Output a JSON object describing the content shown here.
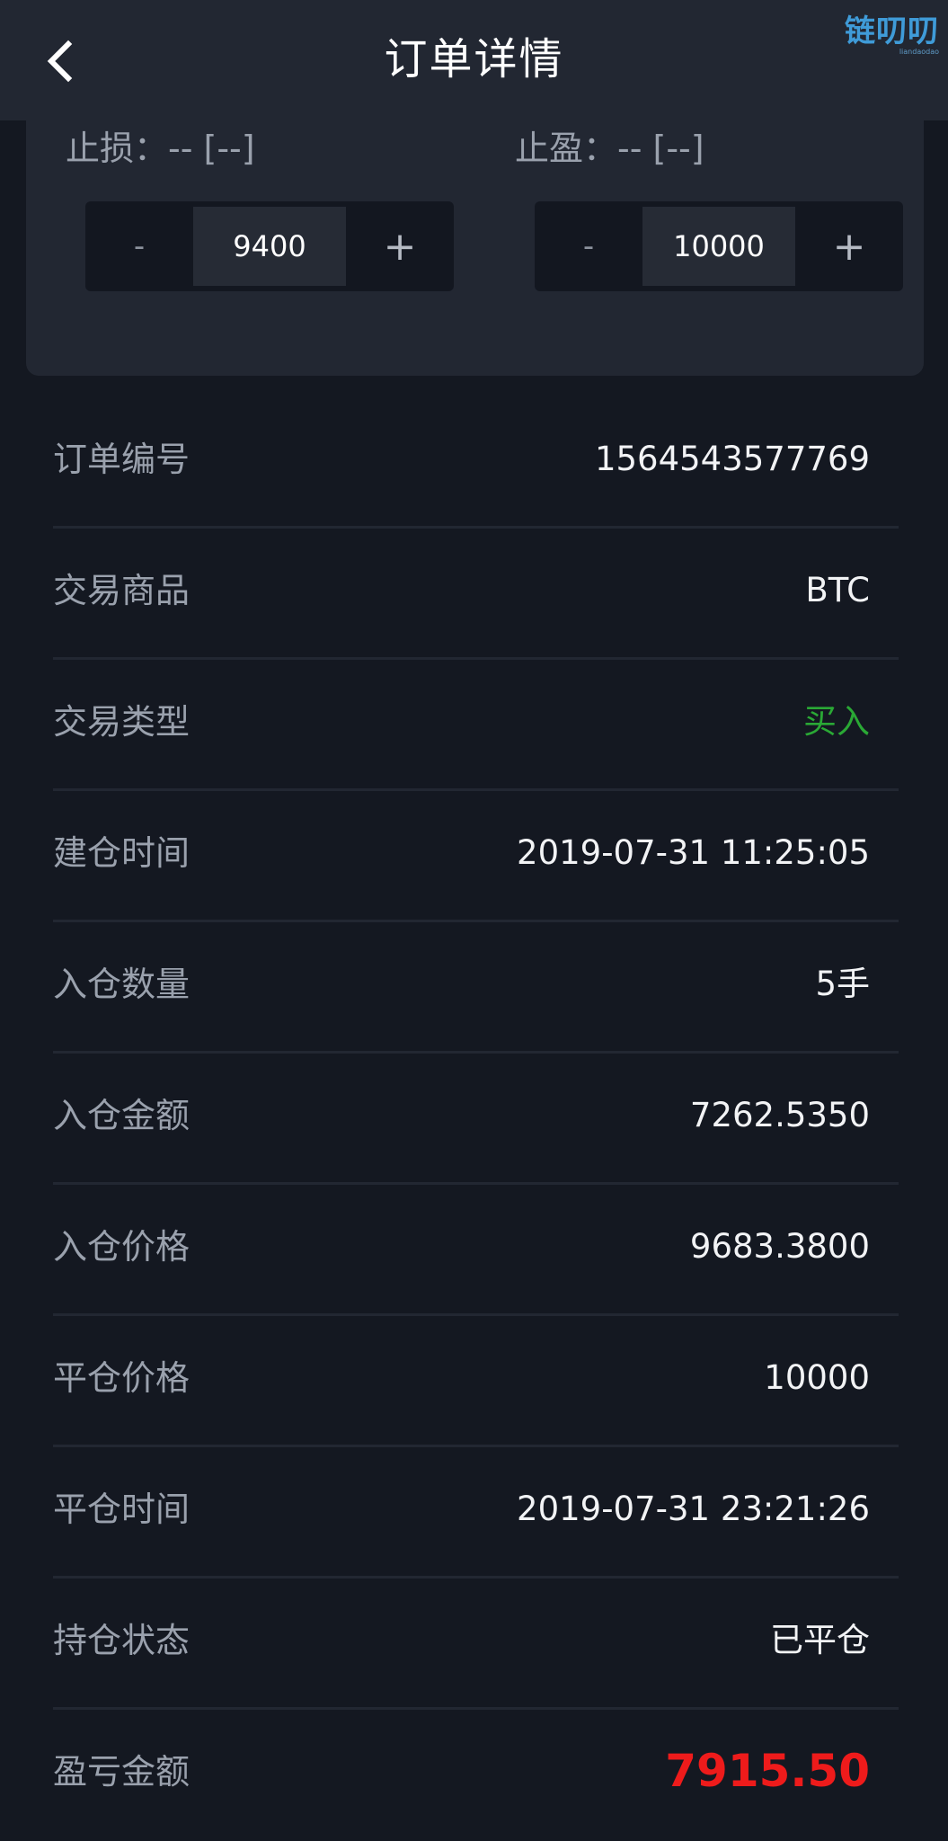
{
  "header": {
    "title": "订单详情",
    "watermark": "链叨叨",
    "watermark_sub": "liandaodao"
  },
  "stop_panel": {
    "stop_loss": {
      "label": "止损：-- [--]",
      "minus": "-",
      "plus": "+",
      "value": "9400"
    },
    "take_profit": {
      "label": "止盈：-- [--]",
      "minus": "-",
      "plus": "+",
      "value": "10000"
    }
  },
  "details": [
    {
      "label": "订单编号",
      "value": "1564543577769"
    },
    {
      "label": "交易商品",
      "value": "BTC"
    },
    {
      "label": "交易类型",
      "value": "买入"
    },
    {
      "label": "建仓时间",
      "value": "2019-07-31 11:25:05"
    },
    {
      "label": "入仓数量",
      "value": "5手"
    },
    {
      "label": "入仓金额",
      "value": "7262.5350"
    },
    {
      "label": "入仓价格",
      "value": "9683.3800"
    },
    {
      "label": "平仓价格",
      "value": "10000"
    },
    {
      "label": "平仓时间",
      "value": "2019-07-31 23:21:26"
    },
    {
      "label": "持仓状态",
      "value": "已平仓"
    },
    {
      "label": "盈亏金额",
      "value": "7915.50"
    }
  ],
  "colors": {
    "background": "#141821",
    "panel": "#222732",
    "buy_green": "#2aa835",
    "profit_red": "#ee1b1b",
    "label_gray": "#9aa1ad"
  },
  "icons": {
    "back": "chevron-left-icon"
  }
}
